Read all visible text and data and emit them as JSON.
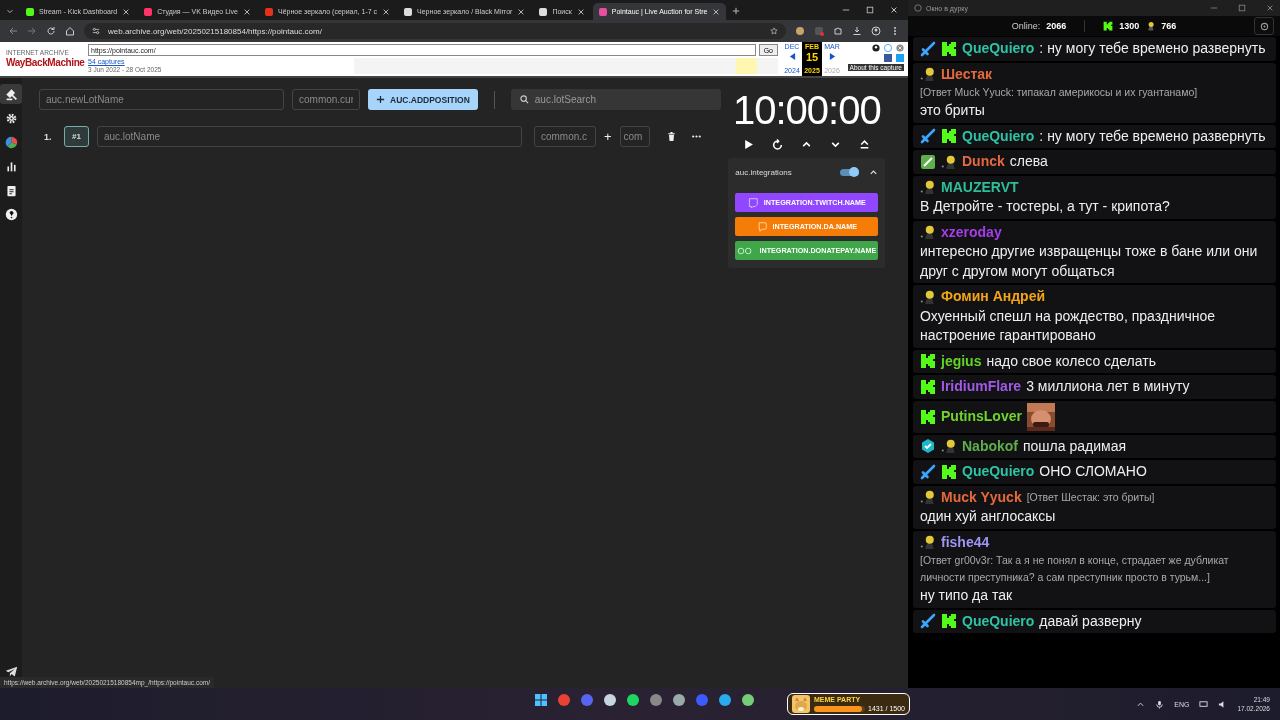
{
  "browser": {
    "tabs": [
      {
        "title": "Stream - Kick Dashboard",
        "color": "#53fc18",
        "selected": false
      },
      {
        "title": "Студия — VK Видео Live",
        "color": "#ff3366",
        "selected": false
      },
      {
        "title": "Чёрное зеркало (сериал, 1-7 с",
        "color": "#e5311c",
        "selected": false
      },
      {
        "title": "Черное зеркало / Black Mirror",
        "color": "#dddddd",
        "selected": false
      },
      {
        "title": "Поиск",
        "color": "#dddddd",
        "selected": false
      },
      {
        "title": "Pointauc | Live Auction for Stre",
        "color": "#e94fa0",
        "selected": true
      }
    ],
    "address": "web.archive.org/web/20250215180854/https://pointauc.com/",
    "status_url": "https://web.archive.org/web/20250215180854mp_/https://pointauc.com/"
  },
  "wayback": {
    "logo_top": "INTERNET ARCHIVE",
    "logo": "WayBackMachine",
    "url": "https://pointauc.com/",
    "go": "Go",
    "captures": "54 captures",
    "range": "3 Jun 2022 - 28 Oct 2025",
    "about": "About this capture",
    "months": [
      {
        "label": "DEC",
        "year": "2024",
        "selected": false,
        "disabled": false
      },
      {
        "label": "FEB",
        "day": "15",
        "year": "2025",
        "selected": true,
        "disabled": false
      },
      {
        "label": "MAR",
        "year": "2026",
        "selected": false,
        "disabled": true
      }
    ]
  },
  "app": {
    "rail": [
      {
        "kind": "gavel",
        "selected": true
      },
      {
        "kind": "settings",
        "selected": false
      },
      {
        "kind": "pie",
        "selected": false
      },
      {
        "kind": "bars",
        "selected": false
      },
      {
        "kind": "clipboard",
        "selected": false
      },
      {
        "kind": "help",
        "selected": false
      }
    ],
    "new_lot": {
      "placeholder": "auc.newLotName"
    },
    "amount": {
      "placeholder": "common.cur"
    },
    "add_button": {
      "label": "AUC.ADDPOSITION"
    },
    "search": {
      "placeholder": "auc.lotSearch"
    },
    "lots": [
      {
        "index": "1.",
        "id": "#1",
        "name_placeholder": "auc.lotName",
        "amount_placeholder": "common.c",
        "plus": "+",
        "extra_placeholder": "com"
      }
    ],
    "timer": "10:00:00",
    "integrations": {
      "title": "auc.integrations",
      "on": true,
      "expanded": true,
      "items": [
        {
          "label": "INTEGRATION.TWITCH.NAME",
          "color": "#9147ff",
          "kind": "twitch"
        },
        {
          "label": "INTEGRATION.DA.NAME",
          "color": "#f57d07",
          "kind": "da"
        },
        {
          "label": "INTEGRATION.DONATEPAY.NAME",
          "color": "#3fa64a",
          "kind": "donatepay"
        }
      ]
    }
  },
  "chat": {
    "title": "Окно в дурку",
    "online_label": "Online:",
    "online": "2066",
    "kick_count": "1300",
    "emote_count": "766",
    "messages": [
      {
        "badges": [
          {
            "kind": "sword"
          },
          {
            "kind": "kick"
          }
        ],
        "user": "QueQuiero",
        "color": "#2ec4a5",
        "text": ": ну могу тебе времено развернуть"
      },
      {
        "badges": [
          {
            "kind": "avatar"
          }
        ],
        "user": "Шестак",
        "color": "#e4693c",
        "reply": "[Ответ Muck Yyuck: типакал америкосы и их гуантанамо]",
        "text": "это бриты"
      },
      {
        "badges": [
          {
            "kind": "sword"
          },
          {
            "kind": "kick"
          }
        ],
        "user": "QueQuiero",
        "color": "#2ec4a5",
        "text": ": ну могу тебе времено развернуть"
      },
      {
        "badges": [
          {
            "kind": "pencil"
          },
          {
            "kind": "avatar"
          }
        ],
        "user": "Dunck",
        "color": "#e4693c",
        "text": "слева"
      },
      {
        "badges": [
          {
            "kind": "avatar"
          }
        ],
        "user": "MAUZERVT",
        "color": "#2ebf9a",
        "text": "В Детройте - тостеры, а тут - крипота?"
      },
      {
        "badges": [
          {
            "kind": "avatar"
          }
        ],
        "user": "xzeroday",
        "color": "#a53ee8",
        "text": "интересно другие извращенцы тоже в бане или они друг с другом могут общаться"
      },
      {
        "badges": [
          {
            "kind": "avatar"
          }
        ],
        "user": "Фомин Андрей",
        "color": "#f2a516",
        "text": "Охуенный спешл на рождество, праздничное настроение гарантировано"
      },
      {
        "badges": [
          {
            "kind": "kick"
          }
        ],
        "user": "jegius",
        "color": "#62d424",
        "text": "надо свое колесо сделать"
      },
      {
        "badges": [
          {
            "kind": "kick"
          }
        ],
        "user": "IridiumFlare",
        "color": "#a05ae6",
        "text": "3 миллиона лет в минуту"
      },
      {
        "badges": [
          {
            "kind": "kick"
          }
        ],
        "user": "PutinsLover",
        "color": "#6ed42e",
        "attachment": {
          "kind": "picture"
        }
      },
      {
        "badges": [
          {
            "kind": "verified"
          },
          {
            "kind": "avatar"
          }
        ],
        "user": "Nabokof",
        "color": "#5fae4c",
        "text": "пошла радимая"
      },
      {
        "badges": [
          {
            "kind": "sword"
          },
          {
            "kind": "kick"
          }
        ],
        "user": "QueQuiero",
        "color": "#2ec4a5",
        "text": "ОНО СЛОМАНО"
      },
      {
        "badges": [
          {
            "kind": "avatar"
          }
        ],
        "user": "Muck Yyuck",
        "color": "#e4693c",
        "reply": "[Ответ Шестак: это бриты]",
        "text": "один хуй англосаксы"
      },
      {
        "badges": [
          {
            "kind": "avatar"
          }
        ],
        "user": "fishe44",
        "color": "#9f95f5",
        "reply": "[Ответ gr00v3r: Так а я не понял в конце, страдает же дубликат личности преступника? а сам преступник просто в турьм...]",
        "text": "ну типо да так"
      },
      {
        "badges": [
          {
            "kind": "sword"
          },
          {
            "kind": "kick"
          }
        ],
        "user": "QueQuiero",
        "color": "#2ec4a5",
        "text": "давай разверну"
      }
    ]
  },
  "taskbar": {
    "widget": {
      "title": "MEME PARTY",
      "progress": "1431 / 1500",
      "level": 0.95
    },
    "lang": "ENG",
    "time": "21:49",
    "date": "17.02.2026"
  }
}
